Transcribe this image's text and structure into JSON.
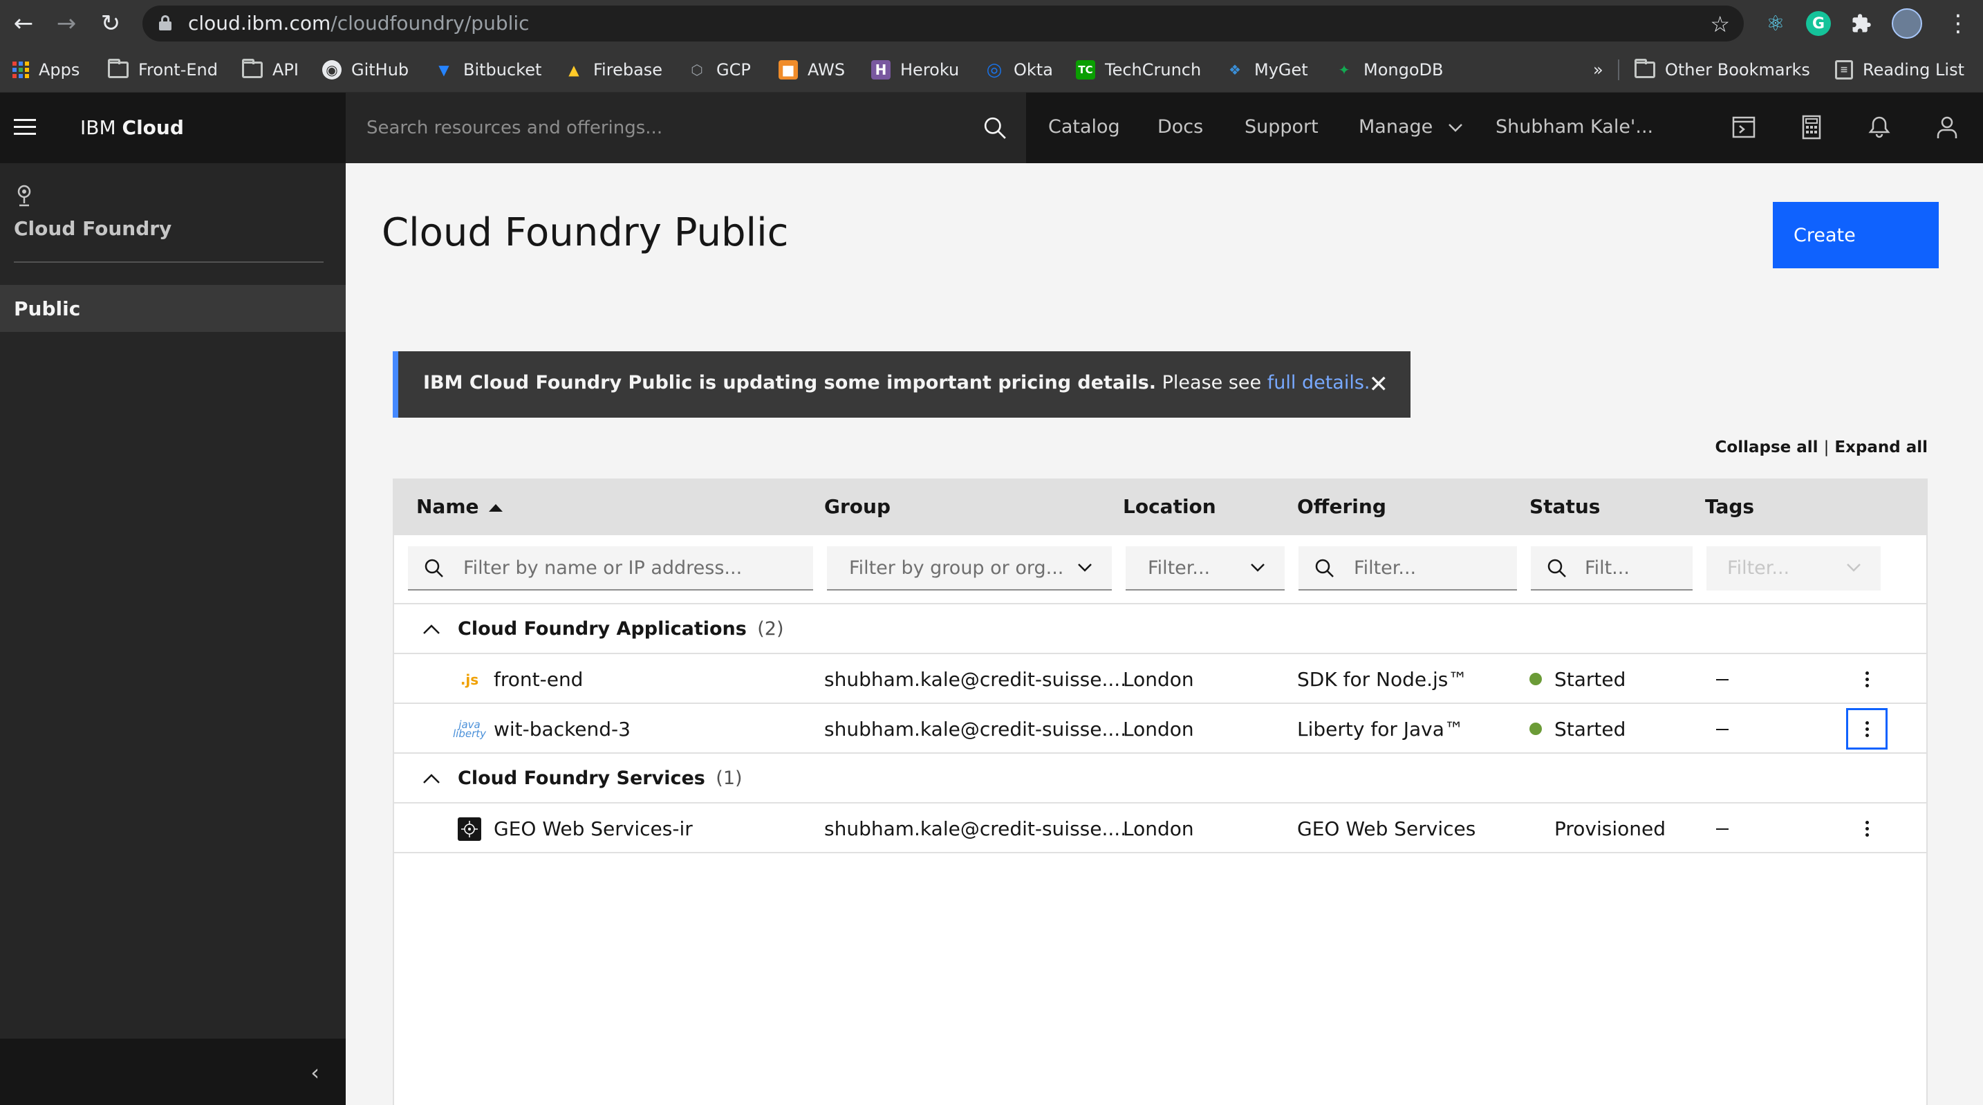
{
  "browser": {
    "url_host": "cloud.ibm.com",
    "url_path": "/cloudfoundry/public",
    "bookmarks": [
      {
        "label": "Apps",
        "icon": "apps-grid-icon"
      },
      {
        "label": "Front-End",
        "icon": "folder-icon"
      },
      {
        "label": "API",
        "icon": "folder-icon"
      },
      {
        "label": "GitHub",
        "icon": "github-icon"
      },
      {
        "label": "Bitbucket",
        "icon": "bitbucket-icon"
      },
      {
        "label": "Firebase",
        "icon": "firebase-icon"
      },
      {
        "label": "GCP",
        "icon": "gcp-icon"
      },
      {
        "label": "AWS",
        "icon": "aws-icon"
      },
      {
        "label": "Heroku",
        "icon": "heroku-icon"
      },
      {
        "label": "Okta",
        "icon": "okta-icon"
      },
      {
        "label": "TechCrunch",
        "icon": "techcrunch-icon"
      },
      {
        "label": "MyGet",
        "icon": "myget-icon"
      },
      {
        "label": "MongoDB",
        "icon": "mongodb-icon"
      }
    ],
    "overflow_label": "»",
    "other_bookmarks": "Other Bookmarks",
    "reading_list": "Reading List"
  },
  "header": {
    "brand_prefix": "IBM",
    "brand_suffix": "Cloud",
    "search_placeholder": "Search resources and offerings...",
    "nav": {
      "catalog": "Catalog",
      "docs": "Docs",
      "support": "Support",
      "manage": "Manage",
      "account": "Shubham Kale'..."
    }
  },
  "sidebar": {
    "title": "Cloud Foundry",
    "items": [
      {
        "label": "Public",
        "active": true
      }
    ]
  },
  "main": {
    "title": "Cloud Foundry Public",
    "create_label": "Create",
    "notification": {
      "bold_text": "IBM Cloud Foundry Public is updating some important pricing details.",
      "text": "Please see",
      "link": "full details."
    },
    "collapse_all": "Collapse all",
    "separator": "|",
    "expand_all": "Expand all"
  },
  "table": {
    "columns": {
      "name": "Name",
      "group": "Group",
      "location": "Location",
      "offering": "Offering",
      "status": "Status",
      "tags": "Tags"
    },
    "filters": {
      "name": "Filter by name or IP address...",
      "group": "Filter by group or org...",
      "location": "Filter...",
      "offering": "Filter...",
      "status": "Filt...",
      "tags": "Filter..."
    },
    "groups": [
      {
        "title": "Cloud Foundry Applications",
        "count": "(2)",
        "rows": [
          {
            "icon": "nodejs-icon",
            "name": "front-end",
            "group": "shubham.kale@credit-suisse....",
            "location": "London",
            "offering": "SDK for Node.js™",
            "status": "Started",
            "status_color": "#6b9b37",
            "tags": "–"
          },
          {
            "icon": "java-liberty-icon",
            "name": "wit-backend-3",
            "group": "shubham.kale@credit-suisse....",
            "location": "London",
            "offering": "Liberty for Java™",
            "status": "Started",
            "status_color": "#6b9b37",
            "tags": "–"
          }
        ]
      },
      {
        "title": "Cloud Foundry Services",
        "count": "(1)",
        "rows": [
          {
            "icon": "geo-web-services-icon",
            "name": "GEO Web Services-ir",
            "group": "shubham.kale@credit-suisse....",
            "location": "London",
            "offering": "GEO Web Services",
            "status": "Provisioned",
            "tags": "–"
          }
        ]
      }
    ]
  },
  "colors": {
    "primary": "#0f62fe",
    "header_bg": "#161616",
    "sidebar_bg": "#262626",
    "status_started": "#6b9b37",
    "notification_border": "#4589ff"
  }
}
